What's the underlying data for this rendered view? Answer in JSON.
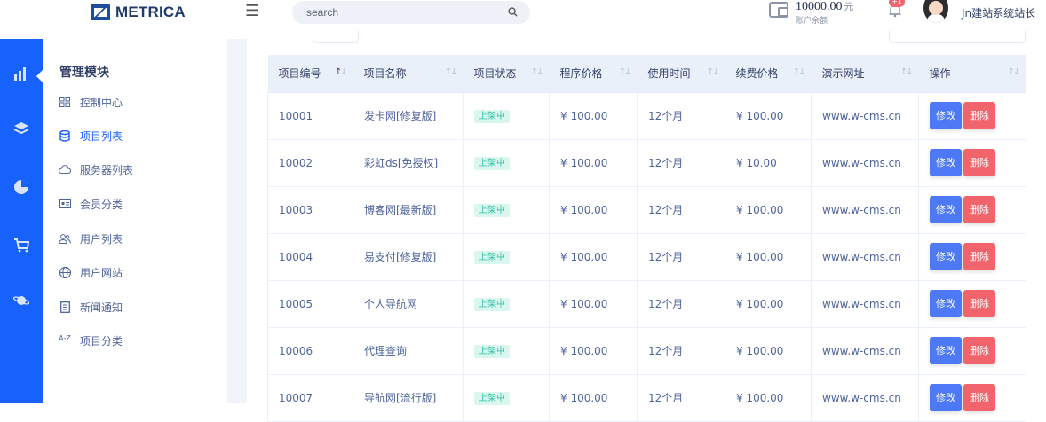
{
  "header": {
    "brand": "METRICA",
    "search_placeholder": "search",
    "balance_amount": "10000.00",
    "balance_unit": "元",
    "balance_label": "账户余额",
    "notification_count": "+1",
    "user_name": "Jn建站系统站长"
  },
  "sidebar": {
    "title": "管理模块",
    "items": [
      {
        "label": "控制中心",
        "icon": "grid-icon"
      },
      {
        "label": "项目列表",
        "icon": "database-icon",
        "active": true
      },
      {
        "label": "服务器列表",
        "icon": "cloud-icon"
      },
      {
        "label": "会员分类",
        "icon": "id-card-icon"
      },
      {
        "label": "用户列表",
        "icon": "users-icon"
      },
      {
        "label": "用户网站",
        "icon": "globe-icon"
      },
      {
        "label": "新闻通知",
        "icon": "document-icon"
      },
      {
        "label": "项目分类",
        "icon": "a-z-icon"
      }
    ]
  },
  "iconbar": [
    "analytics-icon",
    "layers-icon",
    "pie-chart-icon",
    "cart-icon",
    "planet-icon"
  ],
  "table": {
    "headers": [
      "项目编号",
      "项目名称",
      "项目状态",
      "程序价格",
      "使用时间",
      "续费价格",
      "演示网址",
      "操作"
    ],
    "edit_label": "修改",
    "delete_label": "删除",
    "rows": [
      {
        "id": "10001",
        "name": "发卡网[修复版]",
        "status": "上架中",
        "price": "¥ 100.00",
        "duration": "12个月",
        "renew": "¥ 100.00",
        "url": "www.w-cms.cn"
      },
      {
        "id": "10002",
        "name": "彩虹ds[免授权]",
        "status": "上架中",
        "price": "¥ 100.00",
        "duration": "12个月",
        "renew": "¥ 10.00",
        "url": "www.w-cms.cn"
      },
      {
        "id": "10003",
        "name": "博客网[最新版]",
        "status": "上架中",
        "price": "¥ 100.00",
        "duration": "12个月",
        "renew": "¥ 100.00",
        "url": "www.w-cms.cn"
      },
      {
        "id": "10004",
        "name": "易支付[修复版]",
        "status": "上架中",
        "price": "¥ 100.00",
        "duration": "12个月",
        "renew": "¥ 100.00",
        "url": "www.w-cms.cn"
      },
      {
        "id": "10005",
        "name": "个人导航网",
        "status": "上架中",
        "price": "¥ 100.00",
        "duration": "12个月",
        "renew": "¥ 100.00",
        "url": "www.w-cms.cn"
      },
      {
        "id": "10006",
        "name": "代理查询",
        "status": "上架中",
        "price": "¥ 100.00",
        "duration": "12个月",
        "renew": "¥ 100.00",
        "url": "www.w-cms.cn"
      },
      {
        "id": "10007",
        "name": "导航网[流行版]",
        "status": "上架中",
        "price": "¥ 100.00",
        "duration": "12个月",
        "renew": "¥ 100.00",
        "url": "www.w-cms.cn"
      }
    ]
  },
  "colors": {
    "primary": "#1761fd",
    "edit_button": "#4d79f6",
    "delete_button": "#f1646c",
    "status_text": "#2ec4a5",
    "status_bg": "#d9f6ef"
  }
}
